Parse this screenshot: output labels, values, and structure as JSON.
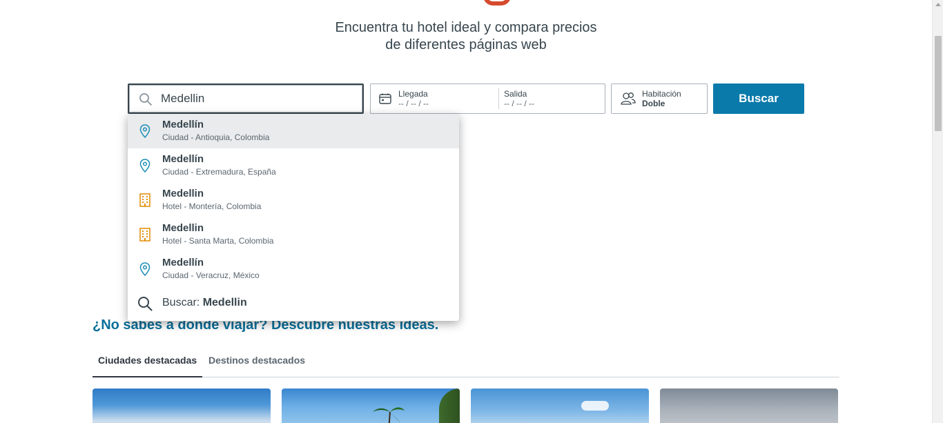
{
  "header": {
    "tagline_line1": "Encuentra tu hotel ideal y compara precios",
    "tagline_line2": "de diferentes páginas web",
    "logo_color": "#d64a2e"
  },
  "search": {
    "destination_value": "Medellin",
    "arrival_label": "Llegada",
    "arrival_value": "-- / -- / --",
    "departure_label": "Salida",
    "departure_value": "-- / -- / --",
    "room_label": "Habitación",
    "room_value": "Doble",
    "button_label": "Buscar",
    "button_color": "#0a7aaa"
  },
  "suggestions": [
    {
      "name": "Medellín",
      "detail": "Ciudad - Antioquia, Colombia",
      "icon": "location-pin-icon",
      "highlighted": true
    },
    {
      "name": "Medellín",
      "detail": "Ciudad - Extremadura, España",
      "icon": "location-pin-icon",
      "highlighted": false
    },
    {
      "name": "Medellin",
      "detail": "Hotel - Montería, Colombia",
      "icon": "hotel-building-icon",
      "highlighted": false
    },
    {
      "name": "Medellin",
      "detail": "Hotel - Santa Marta, Colombia",
      "icon": "hotel-building-icon",
      "highlighted": false
    },
    {
      "name": "Medellín",
      "detail": "Ciudad - Veracruz, México",
      "icon": "location-pin-icon",
      "highlighted": false
    }
  ],
  "search_all": {
    "prefix": "Buscar:",
    "query": "Medellin"
  },
  "ideas": {
    "heading": "¿No sabes a donde viajar? Descubre nuestras ideas.",
    "tabs": [
      {
        "label": "Ciudades destacadas",
        "active": true
      },
      {
        "label": "Destinos destacados",
        "active": false
      }
    ]
  }
}
